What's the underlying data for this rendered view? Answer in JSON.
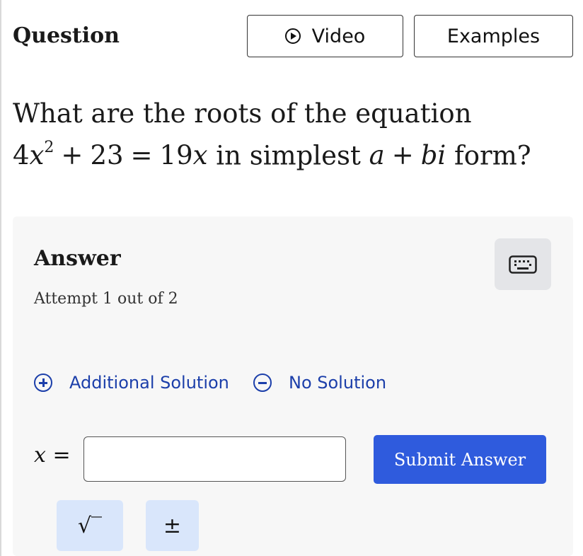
{
  "header": {
    "title": "Question",
    "video_label": "Video",
    "examples_label": "Examples"
  },
  "question": {
    "line1": "What are the roots of the equation",
    "eq_coeff": "4",
    "eq_var": "x",
    "eq_exp": "2",
    "eq_plus": "+",
    "eq_const": "23",
    "eq_equals": "=",
    "eq_rhs_coeff": "19",
    "eq_rhs_var": "x",
    "mid_text": "in simplest",
    "form_a": "a",
    "form_plus": "+",
    "form_bi": "bi",
    "end_text": "form?"
  },
  "answer": {
    "title": "Answer",
    "attempt": "Attempt 1 out of 2",
    "additional_solution": "Additional Solution",
    "no_solution": "No Solution",
    "x_var": "x",
    "x_equals": "=",
    "input_value": "",
    "submit_label": "Submit Answer",
    "sqrt_symbol": "√‾",
    "pm_symbol": "±"
  },
  "colors": {
    "accent": "#2f5bdd",
    "link": "#1c3faa",
    "symbol_button": "#d9e6fb",
    "panel": "#f7f7f7"
  },
  "icons": [
    "play-circle-icon",
    "keyboard-icon",
    "plus-circle-icon",
    "minus-circle-icon"
  ]
}
